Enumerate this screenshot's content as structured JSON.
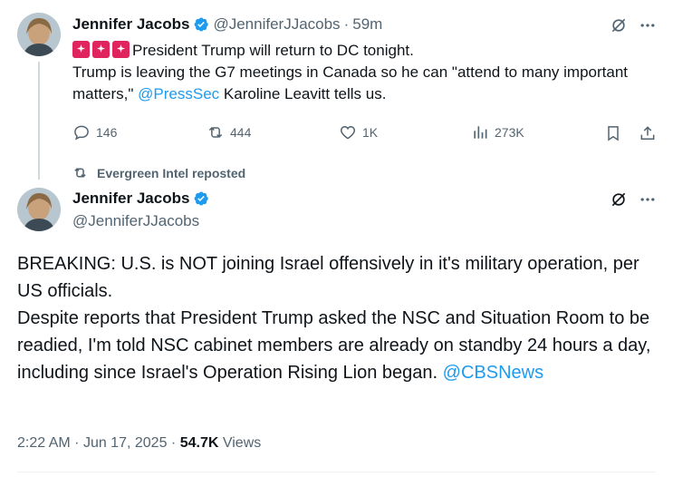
{
  "quoted_tweet": {
    "author_name": "Jennifer Jacobs",
    "author_handle": "@JenniferJJacobs",
    "time_ago": "59m",
    "separator": "·",
    "line1": "President Trump will return to DC tonight.",
    "line2_a": "Trump is leaving the G7 meetings in Canada so he can \"attend to many important matters,\" ",
    "mention": "@PressSec",
    "line2_b": " Karoline Leavitt tells us.",
    "actions": {
      "replies": "146",
      "reposts": "444",
      "likes": "1K",
      "views": "273K"
    }
  },
  "repost_banner": {
    "text": "Evergreen Intel reposted"
  },
  "main_tweet": {
    "author_name": "Jennifer Jacobs",
    "author_handle": "@JenniferJJacobs",
    "para1": "BREAKING: U.S. is NOT joining Israel offensively in it's military operation, per US officials.",
    "para2": "Despite reports that President Trump asked the NSC and Situation Room to be readied, I'm told NSC cabinet members are already on standby 24 hours a day, including since Israel's Operation Rising Lion began. ",
    "mention": "@CBSNews",
    "time": "2:22 AM",
    "date": "Jun 17, 2025",
    "sep": "·",
    "views_count": "54.7K",
    "views_label": "Views"
  },
  "colors": {
    "verified_blue": "#1d9bf0",
    "link": "#1d9bf0",
    "muted": "#536471",
    "siren": "#e0245e"
  }
}
